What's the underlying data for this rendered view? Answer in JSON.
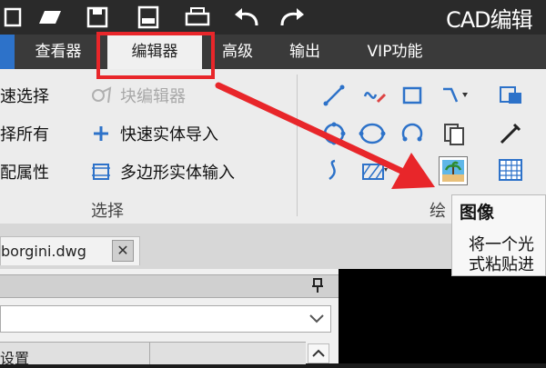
{
  "title_bar": {
    "app_title": "CAD编辑",
    "quick_access_icons": [
      "new-file-icon",
      "open-folder-icon",
      "save-icon",
      "save-pdf-icon",
      "print-icon",
      "undo-icon",
      "redo-icon"
    ]
  },
  "ribbon_tabs": [
    {
      "label": "查看器"
    },
    {
      "label": "编辑器",
      "active": true
    },
    {
      "label": "高级"
    },
    {
      "label": "输出"
    },
    {
      "label": "VIP功能"
    }
  ],
  "select_group": {
    "label": "选择",
    "items": [
      {
        "label": "速选择"
      },
      {
        "label": "择所有"
      },
      {
        "label": "配属性"
      },
      {
        "label": "块编辑器",
        "disabled": true
      },
      {
        "label": "快速实体导入"
      },
      {
        "label": "多边形实体输入"
      }
    ]
  },
  "draw_group": {
    "label": "绘",
    "tool_icons": [
      "line-icon",
      "freehand-icon",
      "rectangle-icon",
      "polyline-icon",
      "text-icon",
      "circle-icon",
      "ellipse-icon",
      "arc-icon",
      "copy-icon",
      "pen-icon",
      "spline-icon",
      "hatch-icon",
      "image-icon",
      "table-icon"
    ]
  },
  "tooltip": {
    "title": "图像",
    "lines": [
      "将一个光",
      "式粘贴进"
    ]
  },
  "document": {
    "tab_name": "borgini.dwg",
    "close_label": "✕"
  },
  "side_panel": {
    "field_label": "设置"
  },
  "colors": {
    "highlight_box": "#e8262a",
    "arrow": "#e8262a",
    "tab_bar": "#3a3a3a",
    "active_tab_accent": "#2d72c9"
  }
}
